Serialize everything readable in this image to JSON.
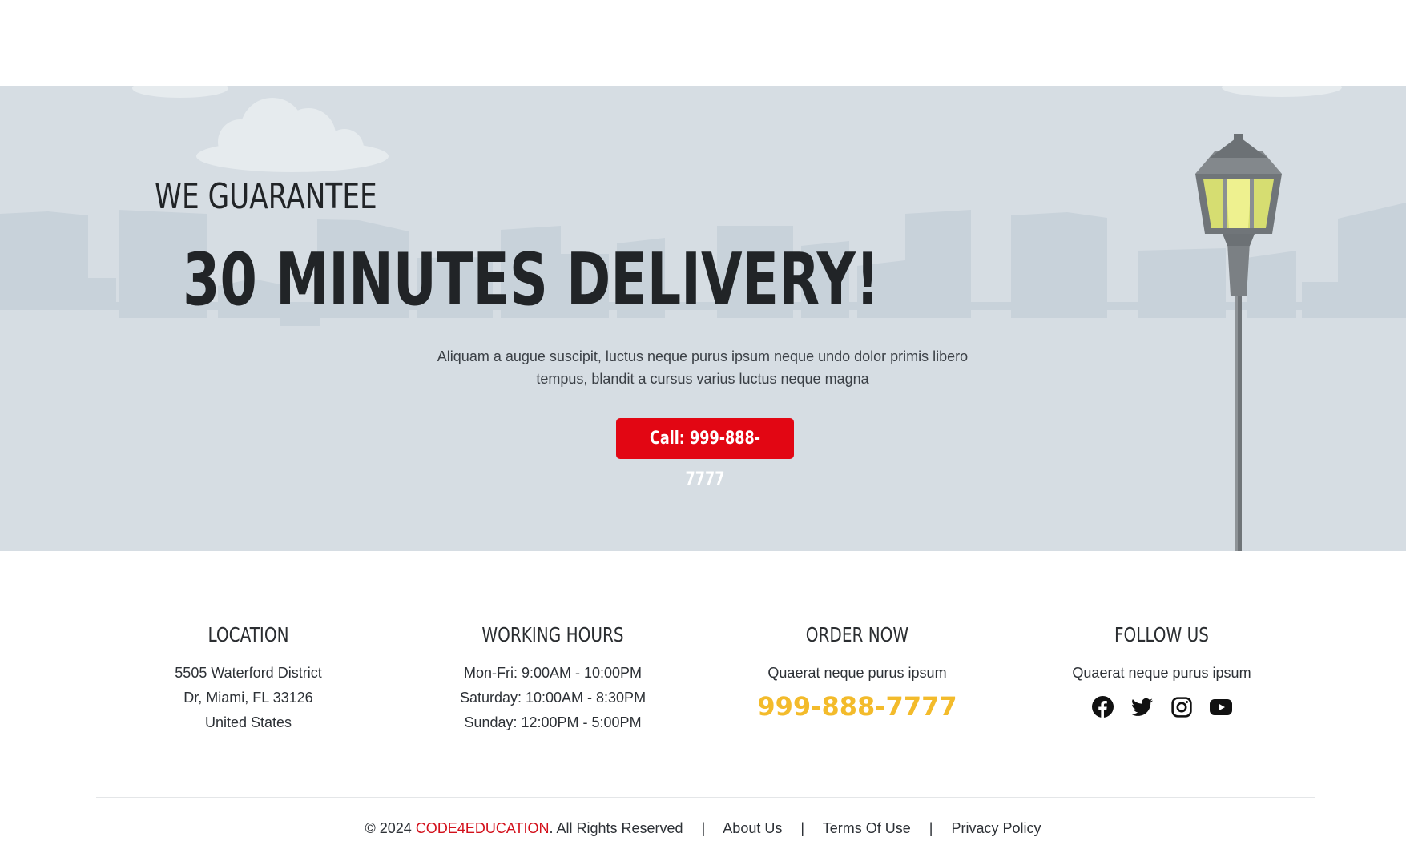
{
  "hero": {
    "eyebrow": "WE GUARANTEE",
    "title": "30 MINUTES DELIVERY!",
    "description": "Aliquam a augue suscipit, luctus neque purus ipsum neque undo dolor primis libero tempus, blandit a cursus varius luctus neque magna",
    "call_button_label": "Call: 999-888-7777"
  },
  "footer": {
    "location": {
      "title": "LOCATION",
      "lines": [
        "5505 Waterford District",
        "Dr, Miami, FL 33126",
        "United States"
      ]
    },
    "hours": {
      "title": "WORKING HOURS",
      "lines": [
        "Mon-Fri: 9:00AM - 10:00PM",
        "Saturday: 10:00AM - 8:30PM",
        "Sunday: 12:00PM - 5:00PM"
      ]
    },
    "order": {
      "title": "ORDER NOW",
      "text": "Quaerat neque purus ipsum",
      "phone": "999-888-7777"
    },
    "follow": {
      "title": "FOLLOW US",
      "text": "Quaerat neque purus ipsum",
      "icons": [
        "facebook-icon",
        "twitter-icon",
        "instagram-icon",
        "youtube-icon"
      ]
    }
  },
  "bottom": {
    "copyright_prefix": "© 2024 ",
    "brand": "CODE4EDUCATION",
    "copyright_suffix": ". All Rights Reserved",
    "separator": "|",
    "links": [
      "About Us",
      "Terms Of Use",
      "Privacy Policy"
    ]
  },
  "colors": {
    "hero_bg": "#d6dde3",
    "accent_red": "#e20613",
    "phone_yellow": "#f3bb2b",
    "brand_red": "#d3101b"
  }
}
